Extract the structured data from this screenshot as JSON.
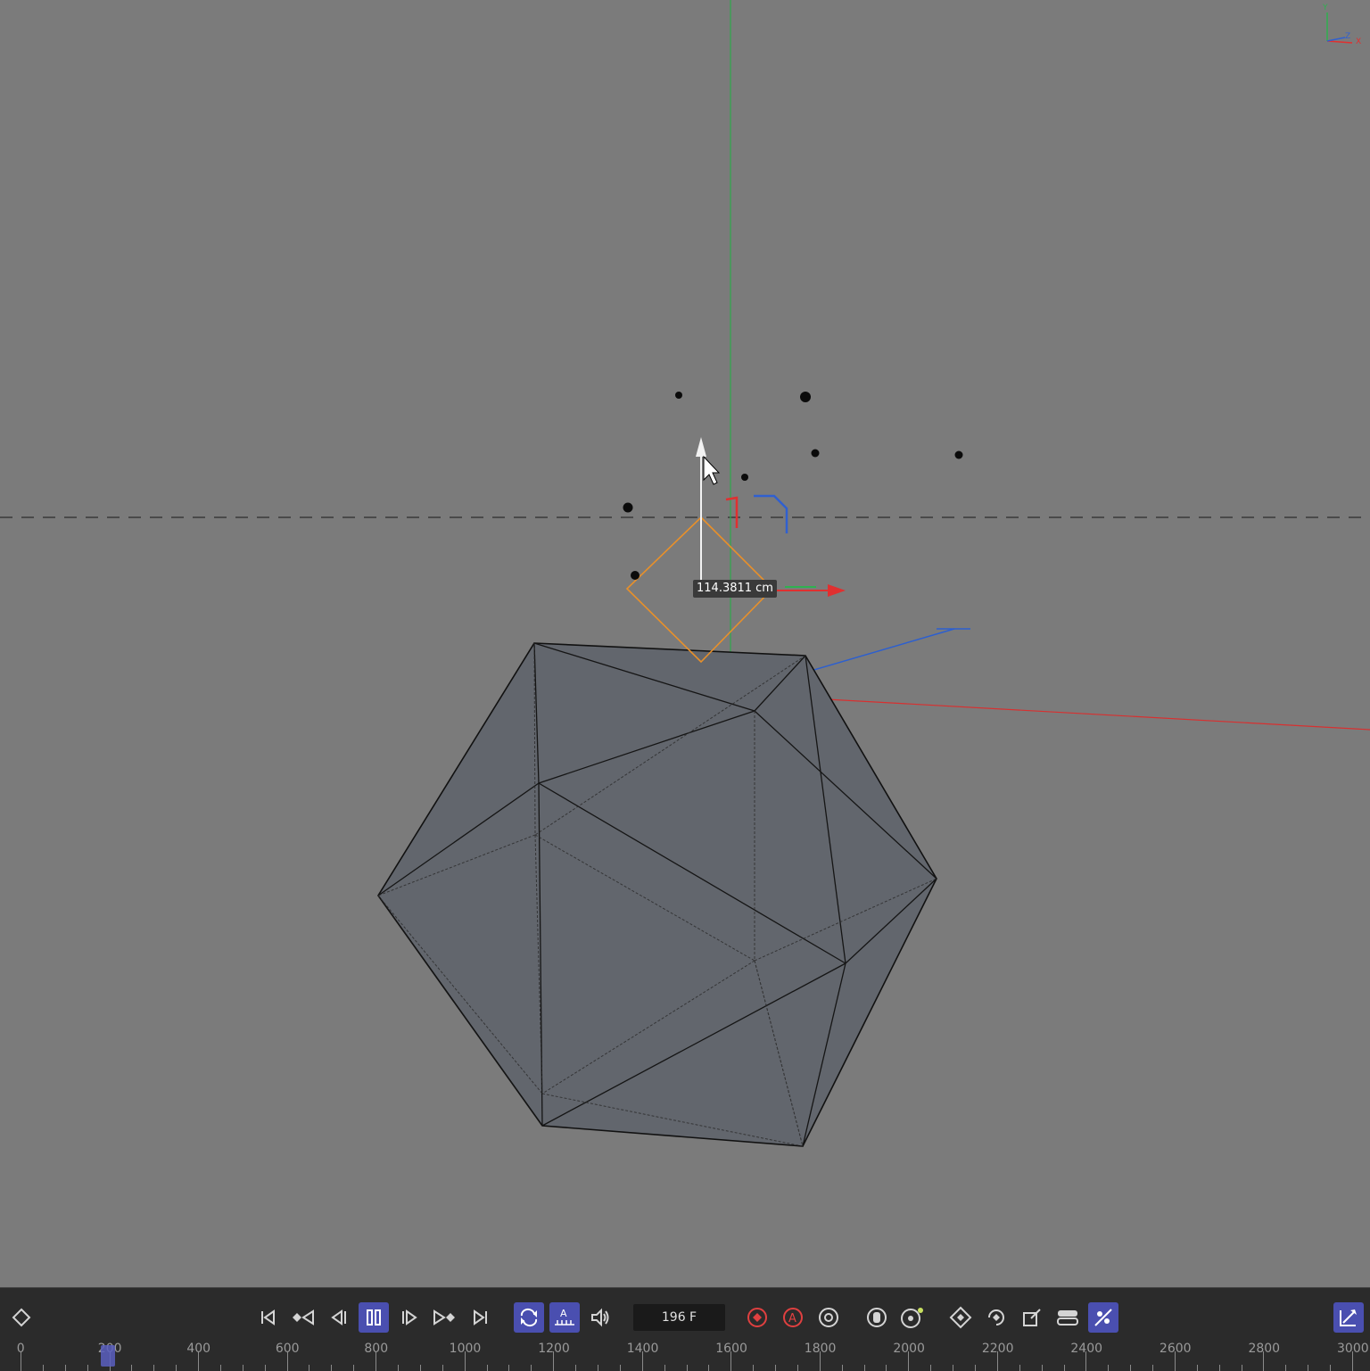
{
  "viewport": {
    "measure_label": "114.3811 cm",
    "axis_gizmo": {
      "y": "Y",
      "z": "Z",
      "x": "X"
    },
    "colors": {
      "background": "#7b7b7b",
      "x_axis": "#e03030",
      "y_axis": "#30b050",
      "z_axis": "#3060d0",
      "handle": "#e8902a"
    }
  },
  "timeline": {
    "keyframe_icon": "diamond-icon",
    "transport": [
      {
        "name": "go-to-start-button",
        "icon": "skip-start-icon",
        "glyph": "|◁"
      },
      {
        "name": "previous-key-button",
        "icon": "prev-key-icon",
        "glyph": "◆◁"
      },
      {
        "name": "previous-frame-button",
        "icon": "prev-frame-icon",
        "glyph": "◁|"
      },
      {
        "name": "pause-button",
        "icon": "pause-icon",
        "glyph": "▯▯"
      },
      {
        "name": "next-frame-button",
        "icon": "next-frame-icon",
        "glyph": "|▷"
      },
      {
        "name": "next-key-button",
        "icon": "next-key-icon",
        "glyph": "▷◆"
      },
      {
        "name": "go-to-end-button",
        "icon": "skip-end-icon",
        "glyph": "▷|"
      }
    ],
    "current_frame": "196 F",
    "ruler_labels": [
      "0",
      "200",
      "400",
      "600",
      "800",
      "1000",
      "1200",
      "1400",
      "1600",
      "1800",
      "2000",
      "2200",
      "2400",
      "2600",
      "2800",
      "3000"
    ],
    "playhead_frame": 196,
    "accent_color": "#4a4fb0"
  }
}
